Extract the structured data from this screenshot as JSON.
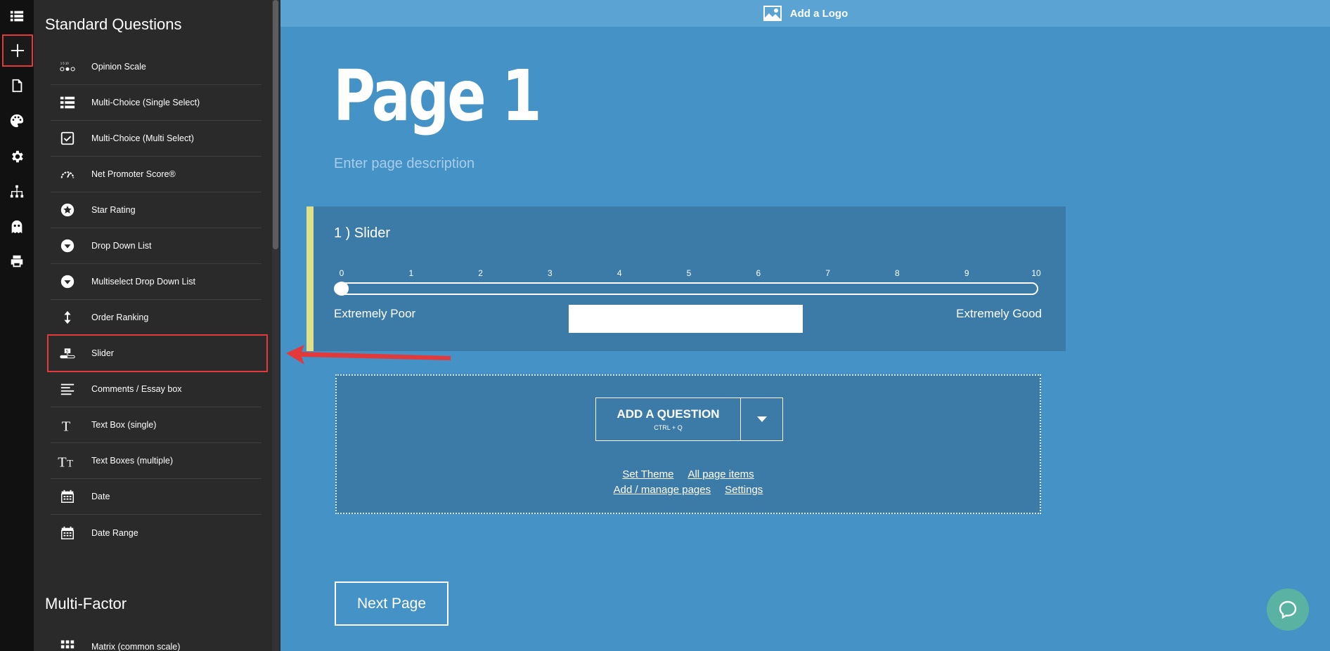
{
  "rail": {
    "items": [
      {
        "icon": "list-icon",
        "active": false
      },
      {
        "icon": "plus-icon",
        "active": true
      },
      {
        "icon": "page-icon",
        "active": false
      },
      {
        "icon": "palette-icon",
        "active": false
      },
      {
        "icon": "gear-icon",
        "active": false
      },
      {
        "icon": "sitemap-icon",
        "active": false
      },
      {
        "icon": "ghost-icon",
        "active": false
      },
      {
        "icon": "print-icon",
        "active": false
      }
    ]
  },
  "panel": {
    "standard_heading": "Standard Questions",
    "multi_heading": "Multi-Factor",
    "items": [
      {
        "label": "Opinion Scale",
        "icon": "opinion-scale-icon"
      },
      {
        "label": "Multi-Choice (Single Select)",
        "icon": "list-icon"
      },
      {
        "label": "Multi-Choice (Multi Select)",
        "icon": "checkbox-icon"
      },
      {
        "label": "Net Promoter Score®",
        "icon": "gauge-icon"
      },
      {
        "label": "Star Rating",
        "icon": "star-icon"
      },
      {
        "label": "Drop Down List",
        "icon": "dropdown-icon"
      },
      {
        "label": "Multiselect Drop Down List",
        "icon": "dropdown-icon"
      },
      {
        "label": "Order Ranking",
        "icon": "sort-icon"
      },
      {
        "label": "Slider",
        "icon": "slider-icon",
        "highlighted": true
      },
      {
        "label": "Comments / Essay box",
        "icon": "paragraph-icon"
      },
      {
        "label": "Text Box (single)",
        "icon": "text-icon"
      },
      {
        "label": "Text Boxes (multiple)",
        "icon": "text-multiple-icon"
      },
      {
        "label": "Date",
        "icon": "calendar-icon"
      },
      {
        "label": "Date Range",
        "icon": "calendar-icon"
      }
    ],
    "multi_items": [
      {
        "label": "Matrix (common scale)",
        "icon": "grid-icon"
      }
    ]
  },
  "topbar": {
    "logo_label": "Add a Logo"
  },
  "page": {
    "title": "Page 1",
    "description_placeholder": "Enter page description"
  },
  "question": {
    "number": "1 )",
    "title": "Slider",
    "ticks": [
      "0",
      "1",
      "2",
      "3",
      "4",
      "5",
      "6",
      "7",
      "8",
      "9",
      "10"
    ],
    "min_label": "Extremely Poor",
    "max_label": "Extremely Good",
    "value_fraction": 0
  },
  "add_question": {
    "label": "ADD A QUESTION",
    "shortcut": "CTRL + Q",
    "links_row1": [
      "Set Theme",
      "All page items"
    ],
    "links_row2": [
      "Add / manage pages",
      "Settings"
    ]
  },
  "next_page": {
    "label": "Next Page"
  },
  "colors": {
    "annotation": "#e23a3a",
    "accent_bar": "#dfe08a",
    "canvas": "#4592c7"
  }
}
